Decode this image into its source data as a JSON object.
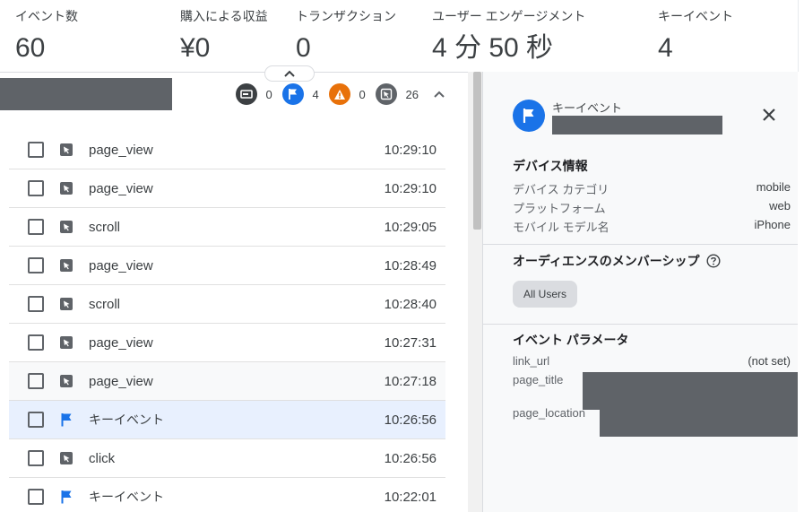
{
  "metrics": [
    {
      "label": "イベント数",
      "value": "60"
    },
    {
      "label": "購入による収益",
      "value": "¥0"
    },
    {
      "label": "トランザクション",
      "value": "0"
    },
    {
      "label": "ユーザー エンゲージメント",
      "value": "4 分 50 秒"
    },
    {
      "label": "キーイベント",
      "value": "4"
    }
  ],
  "counts": [
    {
      "icon": "screen-icon",
      "color": "#3c4043",
      "value": "0"
    },
    {
      "icon": "flag-icon",
      "color": "#1a73e8",
      "value": "4"
    },
    {
      "icon": "warning-icon",
      "color": "#e8710a",
      "value": "0"
    },
    {
      "icon": "cursor-icon",
      "color": "#5f6368",
      "value": "26"
    }
  ],
  "events": [
    {
      "name": "page_view",
      "time": "10:29:10",
      "icon": "cursor-icon"
    },
    {
      "name": "page_view",
      "time": "10:29:10",
      "icon": "cursor-icon"
    },
    {
      "name": "scroll",
      "time": "10:29:05",
      "icon": "cursor-icon"
    },
    {
      "name": "page_view",
      "time": "10:28:49",
      "icon": "cursor-icon"
    },
    {
      "name": "scroll",
      "time": "10:28:40",
      "icon": "cursor-icon"
    },
    {
      "name": "page_view",
      "time": "10:27:31",
      "icon": "cursor-icon"
    },
    {
      "name": "page_view",
      "time": "10:27:18",
      "icon": "cursor-icon"
    },
    {
      "name": "キーイベント",
      "time": "10:26:56",
      "icon": "flag-icon"
    },
    {
      "name": "click",
      "time": "10:26:56",
      "icon": "cursor-icon"
    },
    {
      "name": "キーイベント",
      "time": "10:22:01",
      "icon": "flag-icon"
    }
  ],
  "detail": {
    "header_label": "キーイベント",
    "device": {
      "title": "デバイス情報",
      "rows": [
        {
          "key": "デバイス カテゴリ",
          "value": "mobile"
        },
        {
          "key": "プラットフォーム",
          "value": "web"
        },
        {
          "key": "モバイル モデル名",
          "value": "iPhone"
        }
      ]
    },
    "audience": {
      "title": "オーディエンスのメンバーシップ",
      "chip": "All Users"
    },
    "params": {
      "title": "イベント パラメータ",
      "link_url_key": "link_url",
      "link_url_value": "(not set)",
      "page_title_key": "page_title",
      "page_location_key": "page_location"
    }
  },
  "colors": {
    "accent": "#1a73e8",
    "warning": "#e8710a",
    "selected_row": "#e8f0fe",
    "redaction": "#5f6368"
  }
}
